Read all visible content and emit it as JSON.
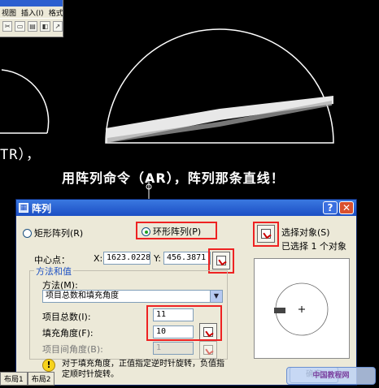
{
  "app": {
    "menu": [
      "视图",
      "插入(I)",
      "格式"
    ],
    "toolbar_icons": [
      "cut-icon",
      "copy-icon",
      "paste-icon",
      "match-icon",
      "pan-icon"
    ]
  },
  "canvas": {
    "command_fragment": "TR），",
    "caption": "用阵列命令（AR），阵列那条直线！"
  },
  "dialog": {
    "title": "阵列",
    "help_label": "?",
    "close_label": "✕",
    "rect_array_label": "矩形阵列(R)",
    "polar_array_label": "环形阵列(P)",
    "select_objects_label": "选择对象(S)",
    "selected_status": "已选择 1 个对象",
    "center_label": "中心点：",
    "x_label": "X:",
    "x_value": "1623.0228",
    "y_label": "Y:",
    "y_value": "456.3871",
    "method_group": "方法和值",
    "method_label": "方法(M):",
    "method_value": "项目总数和填充角度",
    "total_items_label": "项目总数(I):",
    "total_items_value": "11",
    "fill_angle_label": "填充角度(F):",
    "fill_angle_value": "10",
    "item_angle_label": "项目间角度(B):",
    "item_angle_value": "1",
    "note": "对于填充角度，正值指定逆时针旋转，负值指定顺时针旋转。",
    "ok_label": "确定"
  },
  "tabs": [
    "布局1",
    "布局2"
  ],
  "watermark": "中国教程网 www.jcwcn.com"
}
